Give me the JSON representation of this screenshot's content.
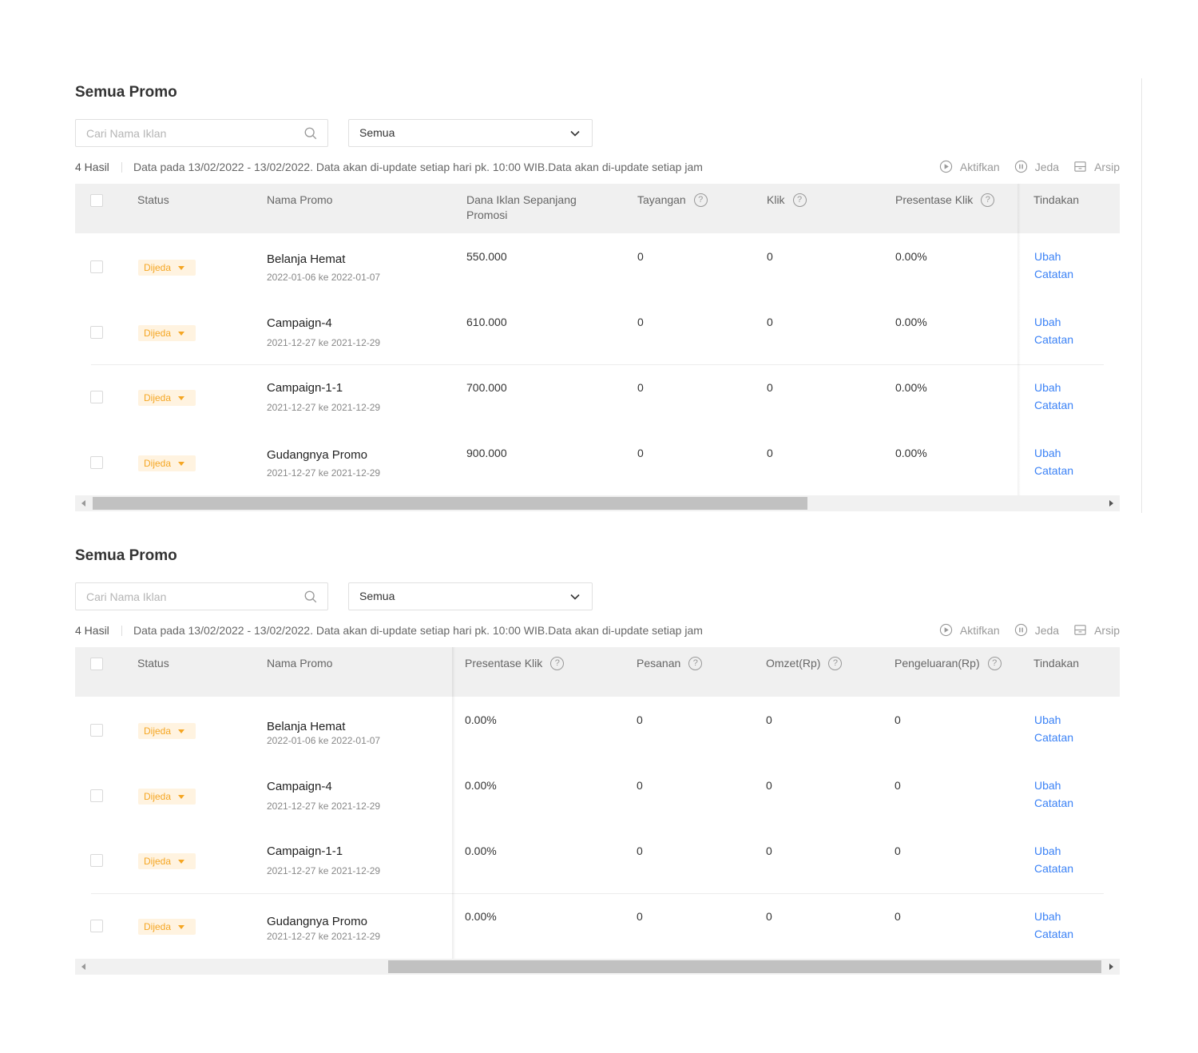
{
  "panels": [
    {
      "title": "Semua Promo",
      "search_placeholder": "Cari Nama Iklan",
      "select_value": "Semua",
      "result_count": "4 Hasil",
      "data_info": "Data pada 13/02/2022 - 13/02/2022. Data akan di-update setiap hari pk. 10:00 WIB.Data akan di-update setiap jam",
      "actions": {
        "activate": "Aktifkan",
        "pause": "Jeda",
        "archive": "Arsip"
      },
      "headers": {
        "status": "Status",
        "name": "Nama Promo",
        "col1": "Dana Iklan Sepanjang Promosi",
        "col2": "Tayangan",
        "col3": "Klik",
        "col4": "Presentase Klik",
        "action": "Tindakan"
      },
      "rows": [
        {
          "status": "Dijeda",
          "name": "Belanja Hemat",
          "date": "2022-01-06 ke 2022-01-07",
          "c1": "550.000",
          "c2": "0",
          "c3": "0",
          "c4": "0.00%",
          "edit": "Ubah",
          "note": "Catatan"
        },
        {
          "status": "Dijeda",
          "name": "Campaign-4",
          "date": "2021-12-27 ke 2021-12-29",
          "c1": "610.000",
          "c2": "0",
          "c3": "0",
          "c4": "0.00%",
          "edit": "Ubah",
          "note": "Catatan"
        },
        {
          "status": "Dijeda",
          "name": "Campaign-1-1",
          "date": "2021-12-27 ke 2021-12-29",
          "c1": "700.000",
          "c2": "0",
          "c3": "0",
          "c4": "0.00%",
          "edit": "Ubah",
          "note": "Catatan"
        },
        {
          "status": "Dijeda",
          "name": "Gudangnya Promo",
          "date": "2021-12-27 ke 2021-12-29",
          "c1": "900.000",
          "c2": "0",
          "c3": "0",
          "c4": "0.00%",
          "edit": "Ubah",
          "note": "Catatan"
        }
      ],
      "scroll_position": 0.0
    },
    {
      "title": "Semua Promo",
      "search_placeholder": "Cari Nama Iklan",
      "select_value": "Semua",
      "result_count": "4 Hasil",
      "data_info": "Data pada 13/02/2022 - 13/02/2022. Data akan di-update setiap hari pk. 10:00 WIB.Data akan di-update setiap jam",
      "actions": {
        "activate": "Aktifkan",
        "pause": "Jeda",
        "archive": "Arsip"
      },
      "headers": {
        "status": "Status",
        "name": "Nama Promo",
        "col1": "Presentase Klik",
        "col2": "Pesanan",
        "col3": "Omzet(Rp)",
        "col4": "Pengeluaran(Rp)",
        "action": "Tindakan"
      },
      "rows": [
        {
          "status": "Dijeda",
          "name": "Belanja Hemat",
          "date": "2022-01-06 ke 2022-01-07",
          "c1": "0.00%",
          "c2": "0",
          "c3": "0",
          "c4": "0",
          "edit": "Ubah",
          "note": "Catatan"
        },
        {
          "status": "Dijeda",
          "name": "Campaign-4",
          "date": "2021-12-27 ke 2021-12-29",
          "c1": "0.00%",
          "c2": "0",
          "c3": "0",
          "c4": "0",
          "edit": "Ubah",
          "note": "Catatan"
        },
        {
          "status": "Dijeda",
          "name": "Campaign-1-1",
          "date": "2021-12-27 ke 2021-12-29",
          "c1": "0.00%",
          "c2": "0",
          "c3": "0",
          "c4": "0",
          "edit": "Ubah",
          "note": "Catatan"
        },
        {
          "status": "Dijeda",
          "name": "Gudangnya Promo",
          "date": "2021-12-27 ke 2021-12-29",
          "c1": "0.00%",
          "c2": "0",
          "c3": "0",
          "c4": "0",
          "edit": "Ubah",
          "note": "Catatan"
        }
      ],
      "scroll_position": 1.0
    }
  ],
  "colors": {
    "link": "#3b82f6",
    "status_text": "#f5a623",
    "status_bg": "#fff3e0",
    "header_bg": "#f0f0f0"
  },
  "icons": {
    "search": "search-icon",
    "dropdown": "chevron-down-icon",
    "activate": "play-circle-icon",
    "pause": "pause-circle-icon",
    "archive": "archive-icon",
    "help": "help-circle-icon"
  }
}
